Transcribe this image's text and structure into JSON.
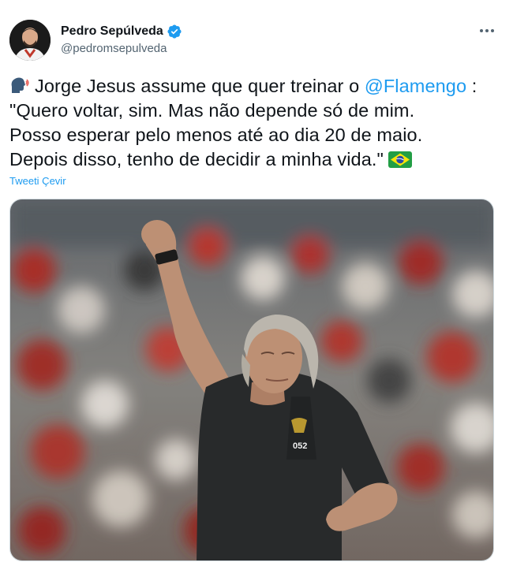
{
  "author": {
    "name": "Pedro Sepúlveda",
    "handle": "@pedromsepulveda",
    "verified": true,
    "avatar_icon": "person-avatar"
  },
  "tweet": {
    "line1_prefix": "Jorge Jesus assume que quer treinar o ",
    "mention": "@Flamengo",
    "line1_suffix": " :",
    "line2": "\"Quero voltar, sim. Mas não depende só de mim.",
    "line3": "Posso esperar pelo menos até ao dia 20 de maio.",
    "line4": "Depois disso, tenho de decidir a minha vida.\"",
    "leading_emoji": "speaking-head-icon",
    "trailing_emoji": "brazil-flag-icon"
  },
  "translate_label": "Tweeti Çevir",
  "more_icon": "more-horizontal-icon",
  "media": {
    "type": "photo"
  },
  "colors": {
    "accent": "#1d9bf0",
    "text": "#0f1419",
    "secondary": "#536471",
    "border": "#cfd9de"
  }
}
